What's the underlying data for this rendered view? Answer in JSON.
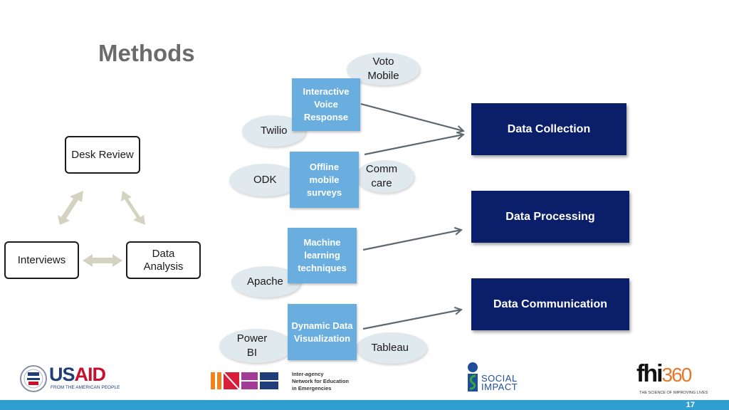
{
  "slide": {
    "title": "Methods",
    "page_number": "17"
  },
  "cycle": {
    "nodes": [
      {
        "id": "desk-review",
        "label": "Desk Review"
      },
      {
        "id": "interviews",
        "label": "Interviews"
      },
      {
        "id": "data-analysis",
        "label": "Data Analysis"
      }
    ]
  },
  "methods": [
    {
      "label": "Interactive Voice Response",
      "tools": [
        "Voto Mobile",
        "Twilio"
      ],
      "target": "Data Collection"
    },
    {
      "label": "Offline mobile surveys",
      "tools": [
        "ODK",
        "Comm care"
      ],
      "target": "Data Collection"
    },
    {
      "label": "Machine learning techniques",
      "tools": [
        "Apache"
      ],
      "target": "Data Processing"
    },
    {
      "label": "Dynamic Data Visualization",
      "tools": [
        "Power BI",
        "Tableau"
      ],
      "target": "Data Communication"
    }
  ],
  "stages": [
    "Data Collection",
    "Data Processing",
    "Data Communication"
  ],
  "logos": {
    "usaid": {
      "name": "USAID",
      "tagline": "FROM THE AMERICAN PEOPLE"
    },
    "inee": {
      "lines": [
        "Inter-agency",
        "Network for Education",
        "in Emergencies"
      ]
    },
    "social_impact": {
      "lines": [
        "SOCIAL",
        "IMPACT"
      ]
    },
    "fhi360": {
      "name_a": "fhi",
      "name_b": "360",
      "tagline": "THE SCIENCE OF IMPROVING LIVES"
    }
  },
  "colors": {
    "method_box": "#6aaee0",
    "stage_box": "#0b1e69",
    "tool_ellipse": "#dfe9ee",
    "cycle_arrow": "#d4d2c0",
    "footer": "#2e9fcf"
  }
}
